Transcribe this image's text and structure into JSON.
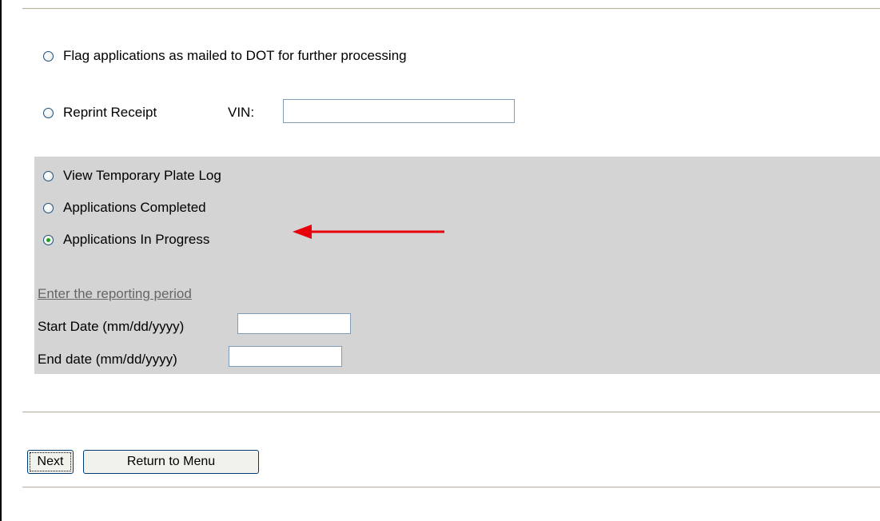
{
  "options": {
    "flag_mailed": {
      "label": "Flag applications as mailed to DOT for further processing",
      "selected": false
    },
    "reprint_receipt": {
      "label": "Reprint Receipt",
      "selected": false,
      "vin_label": "VIN:",
      "vin_value": ""
    },
    "view_plate_log": {
      "label": "View Temporary Plate Log",
      "selected": false
    },
    "apps_completed": {
      "label": "Applications Completed",
      "selected": false
    },
    "apps_in_progress": {
      "label": "Applications In Progress",
      "selected": true
    }
  },
  "reporting": {
    "heading": "Enter the reporting period",
    "start_label": "Start Date (mm/dd/yyyy)",
    "start_value": "",
    "end_label": "End date (mm/dd/yyyy)",
    "end_value": ""
  },
  "buttons": {
    "next_label": "Next",
    "return_label": "Return to Menu"
  },
  "annotation": {
    "arrow_color": "#e8000b"
  }
}
